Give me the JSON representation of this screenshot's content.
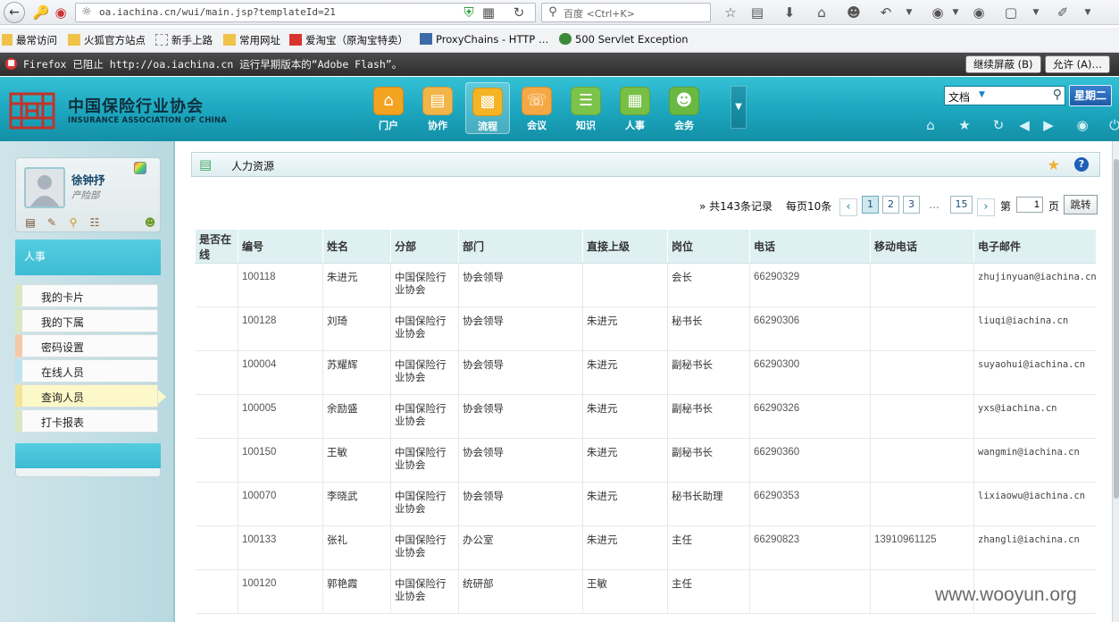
{
  "browser": {
    "url": "oa.iachina.cn/wui/main.jsp?templateId=21",
    "search_placeholder": "百度 <Ctrl+K>",
    "bookmarks": [
      "最常访问",
      "火狐官方站点",
      "新手上路",
      "常用网址",
      "爱淘宝（原淘宝特卖）",
      "ProxyChains - HTTP …",
      "500 Servlet Exception"
    ],
    "notification": "Firefox 已阻止 http://oa.iachina.cn 运行早期版本的“Adobe Flash”。",
    "notify_continue": "继续屏蔽 (B)",
    "notify_allow": "允许 (A)…"
  },
  "header": {
    "logo_cn": "中国保险行业协会",
    "logo_en": "INSURANCE ASSOCIATION OF CHINA",
    "modules": [
      {
        "label": "门户",
        "icon": "home-icon",
        "color": "#f4a321"
      },
      {
        "label": "协作",
        "icon": "clipboard-icon",
        "color": "#f2b548"
      },
      {
        "label": "流程",
        "icon": "chart-icon",
        "color": "#f4b424",
        "active": true
      },
      {
        "label": "会议",
        "icon": "phone-icon",
        "color": "#f5a844"
      },
      {
        "label": "知识",
        "icon": "stack-icon",
        "color": "#7cc34a"
      },
      {
        "label": "人事",
        "icon": "id-card-icon",
        "color": "#78bf45"
      },
      {
        "label": "会务",
        "icon": "meeting-icon",
        "color": "#69b842"
      }
    ],
    "search_category": "文档",
    "weekday": "星期二"
  },
  "sidebar": {
    "user_name": "徐钟抒",
    "user_dept": "产险部",
    "menu_title": "人事",
    "items": [
      {
        "label": "我的卡片",
        "accent": "#d9e8c0"
      },
      {
        "label": "我的下属",
        "accent": "#d9e8c0"
      },
      {
        "label": "密码设置",
        "accent": "#f6c9a6"
      },
      {
        "label": "在线人员",
        "accent": "#bfe3ef"
      },
      {
        "label": "查询人员",
        "accent": "#f2e39a",
        "active": true
      },
      {
        "label": "打卡报表",
        "accent": "#d9e8c0"
      }
    ]
  },
  "panel": {
    "title": "人力资源"
  },
  "pager": {
    "total": "» 共143条记录",
    "per_page": "每页10条",
    "pages": [
      "1",
      "2",
      "3",
      "…",
      "15"
    ],
    "current": "1",
    "page_prefix": "第",
    "page_input": "1",
    "page_suffix": "页",
    "go": "跳转"
  },
  "table": {
    "columns": [
      "是否在线",
      "编号",
      "姓名",
      "分部",
      "部门",
      "直接上级",
      "岗位",
      "电话",
      "移动电话",
      "电子邮件"
    ],
    "rows": [
      [
        "",
        "100118",
        "朱进元",
        "中国保险行业协会",
        "协会领导",
        "",
        "会长",
        "66290329",
        "",
        "zhujinyuan@iachina.cn"
      ],
      [
        "",
        "100128",
        "刘琦",
        "中国保险行业协会",
        "协会领导",
        "朱进元",
        "秘书长",
        "66290306",
        "",
        "liuqi@iachina.cn"
      ],
      [
        "",
        "100004",
        "苏耀辉",
        "中国保险行业协会",
        "协会领导",
        "朱进元",
        "副秘书长",
        "66290300",
        "",
        "suyaohui@iachina.cn"
      ],
      [
        "",
        "100005",
        "余励盛",
        "中国保险行业协会",
        "协会领导",
        "朱进元",
        "副秘书长",
        "66290326",
        "",
        "yxs@iachina.cn"
      ],
      [
        "",
        "100150",
        "王敏",
        "中国保险行业协会",
        "协会领导",
        "朱进元",
        "副秘书长",
        "66290360",
        "",
        "wangmin@iachina.cn"
      ],
      [
        "",
        "100070",
        "李晓武",
        "中国保险行业协会",
        "协会领导",
        "朱进元",
        "秘书长助理",
        "66290353",
        "",
        "lixiaowu@iachina.cn"
      ],
      [
        "",
        "100133",
        "张礼",
        "中国保险行业协会",
        "办公室",
        "朱进元",
        "主任",
        "66290823",
        "13910961125",
        "zhangli@iachina.cn"
      ],
      [
        "",
        "100120",
        "郭艳霞",
        "中国保险行业协会",
        "统研部",
        "王敏",
        "主任",
        "",
        "",
        ""
      ]
    ]
  },
  "watermark": "www.wooyun.org"
}
